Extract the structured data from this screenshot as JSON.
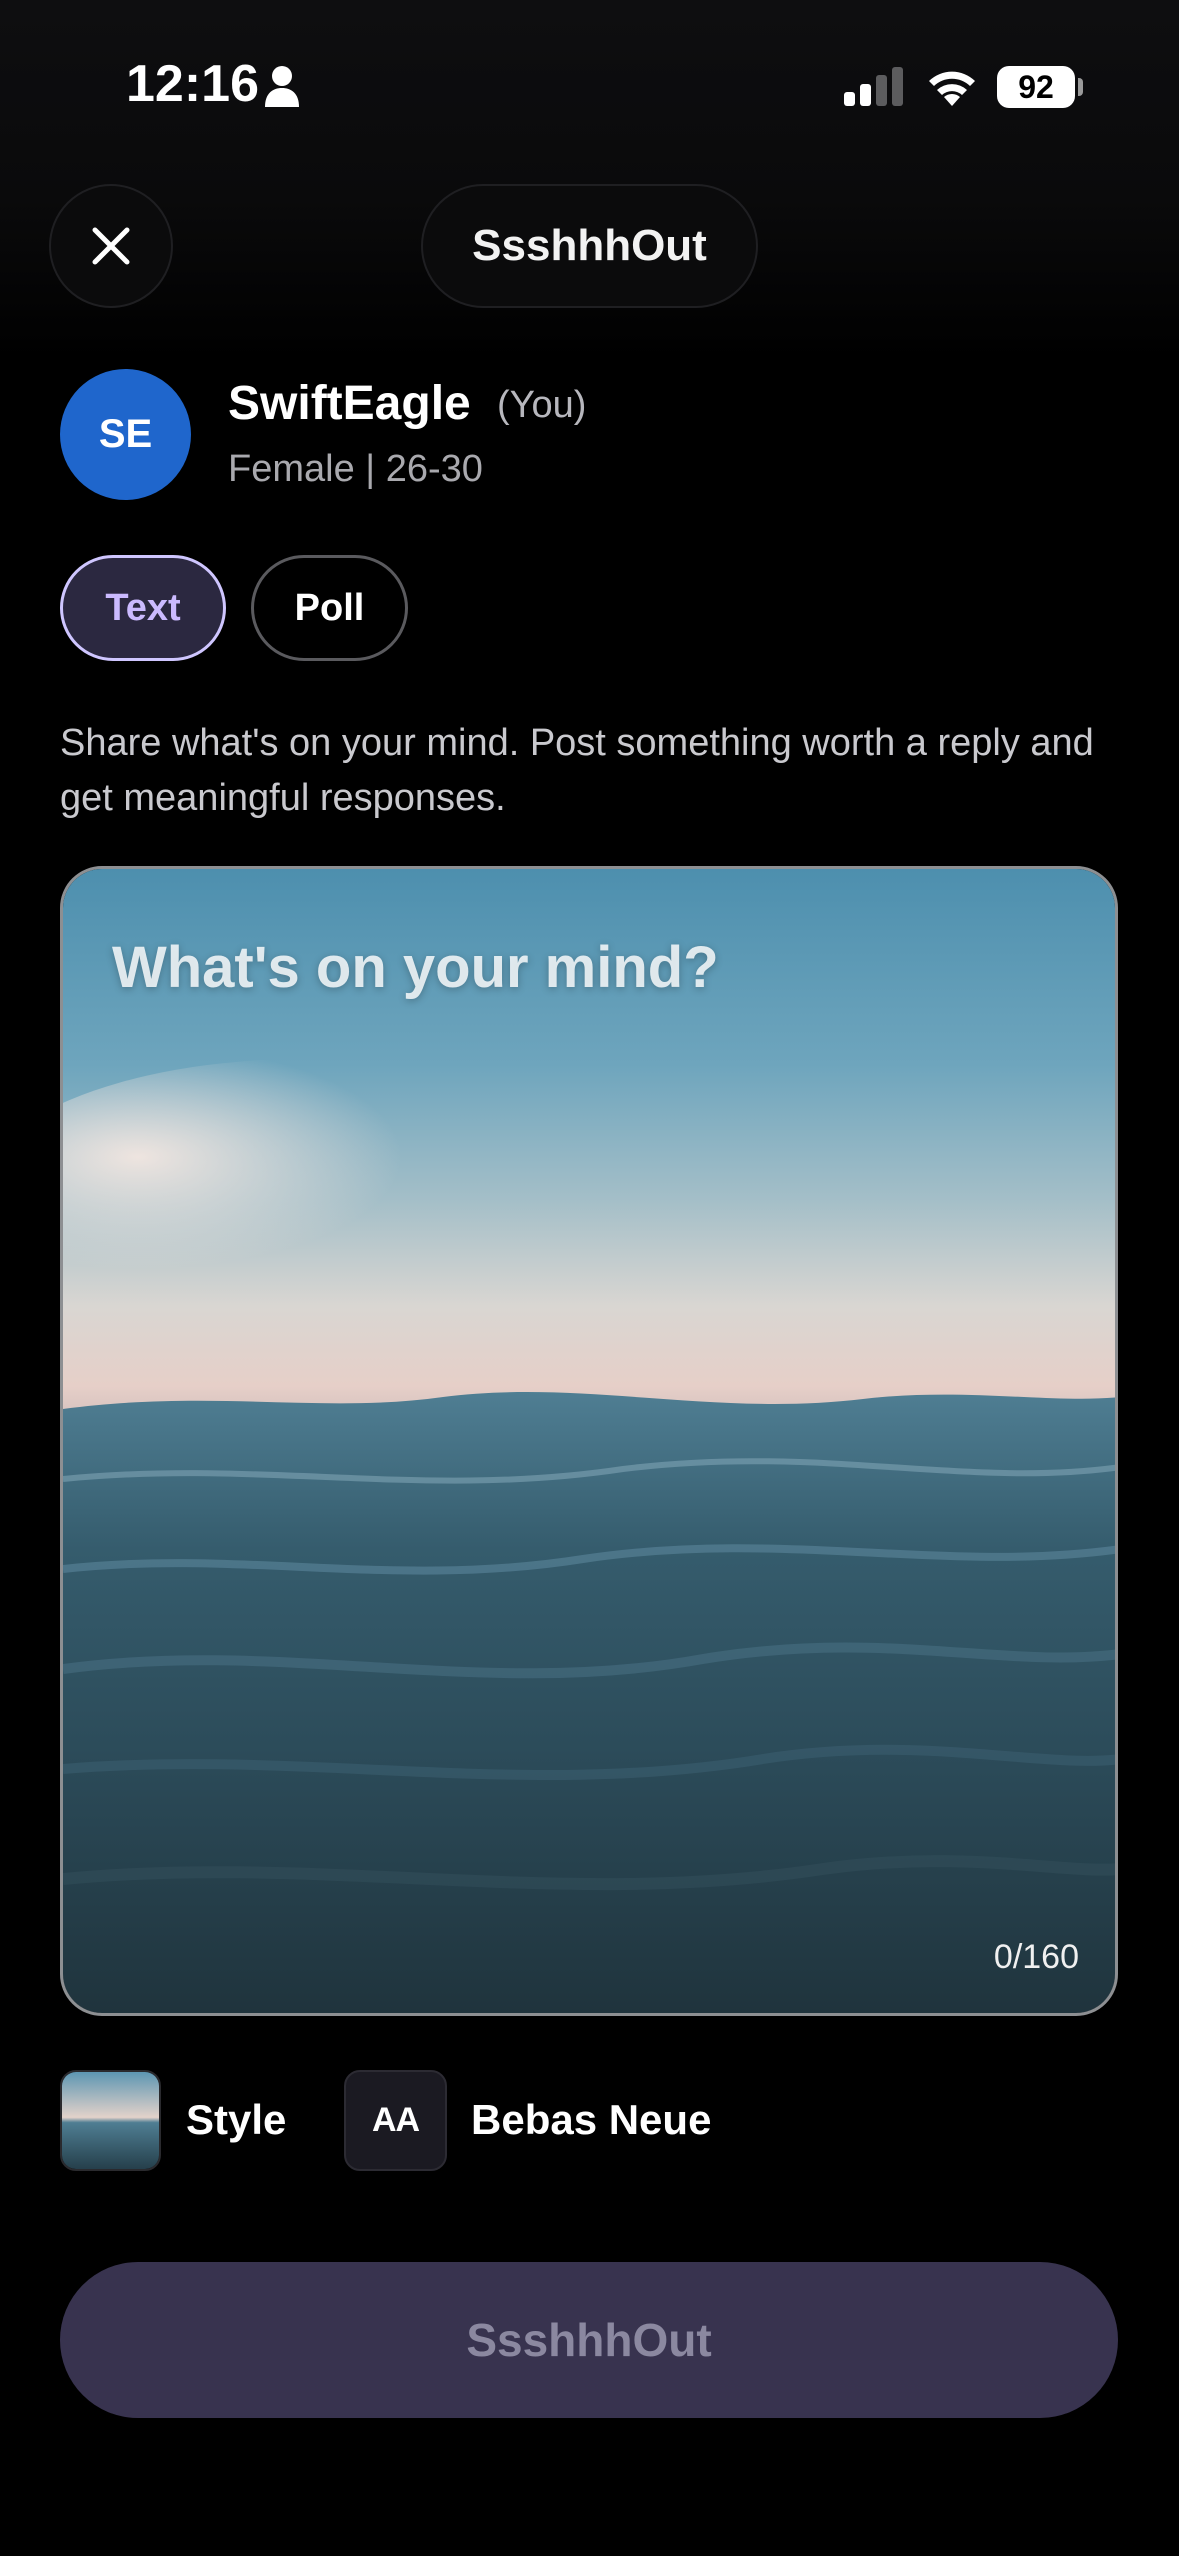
{
  "status_bar": {
    "time": "12:16",
    "battery": "92",
    "icons": [
      "person-icon",
      "signal-icon",
      "wifi-icon",
      "battery-icon"
    ]
  },
  "header": {
    "title": "SsshhhOut",
    "close_icon": "close-icon"
  },
  "profile": {
    "initials": "SE",
    "username": "SwiftEagle",
    "you_tag": "(You)",
    "meta": "Female | 26-30",
    "avatar_color": "#1f66cc"
  },
  "tabs": [
    {
      "label": "Text",
      "selected": true
    },
    {
      "label": "Poll",
      "selected": false
    }
  ],
  "description": "Share what's on your mind. Post something worth a reply and get meaningful responses.",
  "composer": {
    "placeholder": "What's on your mind?",
    "counter": "0/160",
    "background": "ocean-waves-image"
  },
  "options": {
    "style_label": "Style",
    "font_thumb": "AA",
    "font_label": "Bebas Neue"
  },
  "submit": {
    "label": "SsshhhOut",
    "enabled": false
  },
  "colors": {
    "background": "#000000",
    "accent": "#cbbaff",
    "button_disabled": "#38334f"
  }
}
